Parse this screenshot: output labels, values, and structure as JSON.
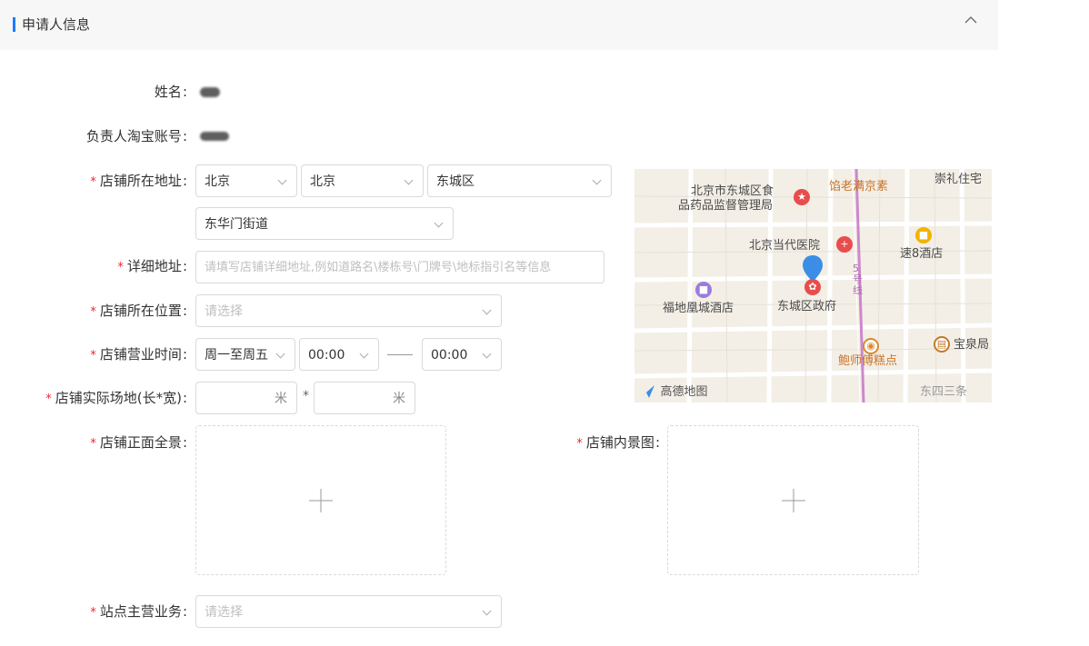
{
  "section": {
    "title": "申请人信息",
    "collapse_icon": "chevron-up-icon"
  },
  "fields": {
    "name": {
      "label": "姓名"
    },
    "taobao": {
      "label": "负责人淘宝账号"
    },
    "address": {
      "label": "店铺所在地址",
      "province": "北京",
      "city": "北京",
      "district": "东城区",
      "street": "东华门街道"
    },
    "detail": {
      "label": "详细地址",
      "placeholder": "请填写店铺详细地址,例如道路名\\楼栋号\\门牌号\\地标指引名等信息"
    },
    "location": {
      "label": "店铺所在位置",
      "placeholder": "请选择"
    },
    "hours": {
      "label": "店铺营业时间",
      "days": "周一至周五",
      "start": "00:00",
      "end": "00:00"
    },
    "area": {
      "label": "店铺实际场地(长*宽)",
      "unit1": "米",
      "times": "*",
      "unit2": "米"
    },
    "front": {
      "label": "店铺正面全景"
    },
    "interior": {
      "label": "店铺内景图"
    },
    "business": {
      "label": "站点主营业务",
      "placeholder": "请选择"
    }
  },
  "map": {
    "labels": {
      "food_bureau_1": "北京市东城区食",
      "food_bureau_2": "品药品监督管理局",
      "restaurant": "馅老满京素",
      "residence": "崇礼住宅",
      "hospital": "北京当代医院",
      "hotel_su8": "速8酒店",
      "hotel_fudi": "福地凰城酒店",
      "gov": "东城区政府",
      "line5": "5号线",
      "bakery": "鲍师傅糕点",
      "baoquan": "宝泉局",
      "street": "东四三条",
      "brand": "高德地图"
    }
  }
}
